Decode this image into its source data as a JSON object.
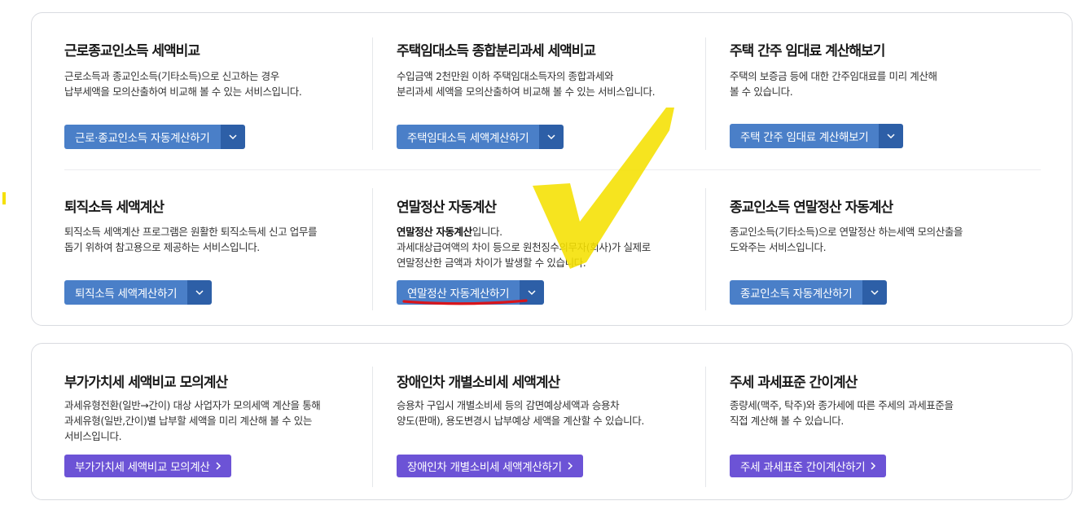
{
  "section1": {
    "cards": [
      {
        "title": "근로종교인소득 세액비교",
        "desc1": "근로소득과 종교인소득(기타소득)으로 신고하는 경우",
        "desc2": "납부세액을 모의산출하여 비교해 볼 수 있는 서비스입니다.",
        "button": "근로·종교인소득 자동계산하기"
      },
      {
        "title": "주택임대소득 종합분리과세 세액비교",
        "desc1": "수입금액 2천만원 이하 주택임대소득자의 종합과세와",
        "desc2": "분리과세 세액을 모의산출하여 비교해 볼 수 있는 서비스입니다.",
        "button": "주택임대소득 세액계산하기"
      },
      {
        "title": "주택 간주 임대료 계산해보기",
        "desc1": "주택의 보증금 등에 대한 간주임대료를 미리 계산해",
        "desc2": "볼 수 있습니다.",
        "button": "주택 간주 임대료 계산해보기"
      },
      {
        "title": "퇴직소득 세액계산",
        "desc1": "퇴직소득 세액계산 프로그램은 원활한 퇴직소득세 신고 업무를",
        "desc2": "돕기 위하여 참고용으로 제공하는 서비스입니다.",
        "button": "퇴직소득 세액계산하기"
      },
      {
        "title": "연말정산 자동계산",
        "desc1_bold": "연말정산 자동계산",
        "desc1_rest": "입니다.",
        "desc2": "과세대상급여액의 차이 등으로 원천징수의무자(회사)가 실제로",
        "desc3": "연말정산한 금액과 차이가 발생할 수 있습니다.",
        "button": "연말정산 자동계산하기"
      },
      {
        "title": "종교인소득 연말정산 자동계산",
        "desc1": "종교인소득(기타소득)으로 연말정산 하는세액 모의산출을",
        "desc2": "도와주는 서비스입니다.",
        "button": "종교인소득 자동계산하기"
      }
    ]
  },
  "section2": {
    "cards": [
      {
        "title": "부가가치세 세액비교 모의계산",
        "desc1": "과세유형전환(일반→간이) 대상 사업자가 모의세액 계산을 통해",
        "desc2": "과세유형(일반,간이)별 납부할 세액을 미리 계산해 볼 수 있는",
        "desc3": "서비스입니다.",
        "button": "부가가치세 세액비교 모의계산"
      },
      {
        "title": "장애인차 개별소비세 세액계산",
        "desc1": "승용차 구입시 개별소비세 등의 감면예상세액과 승용차",
        "desc2": "양도(판매), 용도변경시 납부예상 세액을 계산할 수 있습니다.",
        "button": "장애인차 개별소비세 세액계산하기"
      },
      {
        "title": "주세 과세표준 간이계산",
        "desc1": "종량세(맥주, 탁주)와 종가세에 따른 주세의 과세표준을",
        "desc2": "직접 계산해 볼 수 있습니다.",
        "button": "주세 과세표준 간이계산하기"
      }
    ]
  },
  "colors": {
    "blue_button": "#4a7fc8",
    "blue_dropdown": "#2d5fa7",
    "purple_button": "#6c53d6",
    "checkmark": "#f5e000",
    "underline": "#d9151b"
  }
}
